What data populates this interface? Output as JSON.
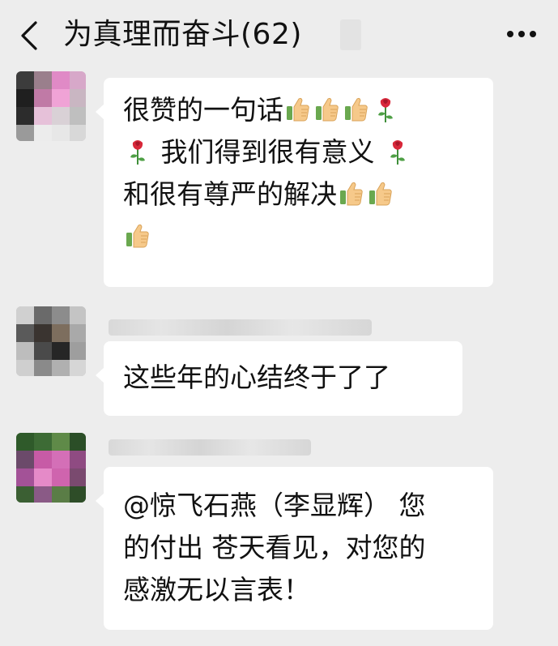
{
  "header": {
    "back_icon": "chevron-left-icon",
    "title": "为真理而奋斗(62)",
    "more_icon": "more-dots-icon"
  },
  "messages": [
    {
      "segments": [
        {
          "type": "text",
          "value": "很赞的一句话"
        },
        {
          "type": "emoji",
          "value": "thumbs-up"
        },
        {
          "type": "emoji",
          "value": "thumbs-up"
        },
        {
          "type": "emoji",
          "value": "thumbs-up"
        },
        {
          "type": "emoji",
          "value": "rose"
        },
        {
          "type": "emoji",
          "value": "rose"
        },
        {
          "type": "text",
          "value": "我们得到很有意义"
        },
        {
          "type": "emoji",
          "value": "rose"
        },
        {
          "type": "text",
          "value": "和很有尊严的解决"
        },
        {
          "type": "emoji",
          "value": "thumbs-up"
        },
        {
          "type": "emoji",
          "value": "thumbs-up"
        },
        {
          "type": "emoji",
          "value": "thumbs-up"
        }
      ]
    },
    {
      "text": "这些年的心结终于了了"
    },
    {
      "lines": [
        "@惊飞石燕（李显辉） 您",
        "的付出 苍天看见，对您的",
        "感激无以言表！"
      ]
    }
  ],
  "colors": {
    "background": "#ededed",
    "bubble": "#ffffff",
    "text": "#111111"
  }
}
